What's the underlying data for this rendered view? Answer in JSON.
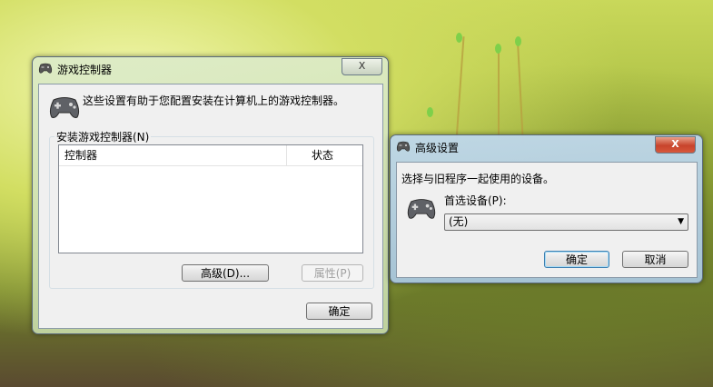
{
  "main_window": {
    "title": "游戏控制器",
    "close_glyph": "X",
    "description": "这些设置有助于您配置安装在计算机上的游戏控制器。",
    "group_label": "安装游戏控制器(N)",
    "columns": [
      "控制器",
      "状态"
    ],
    "rows": [],
    "advanced_button": "高级(D)...",
    "properties_button": "属性(P)",
    "ok_button": "确定"
  },
  "advanced_dialog": {
    "title": "高级设置",
    "close_glyph": "X",
    "instruction": "选择与旧程序一起使用的设备。",
    "preferred_label": "首选设备(P):",
    "preferred_value": "(无)",
    "ok_button": "确定",
    "cancel_button": "取消"
  },
  "colors": {
    "accent_border": "#3c7fb1",
    "close_active": "#c7432b"
  }
}
